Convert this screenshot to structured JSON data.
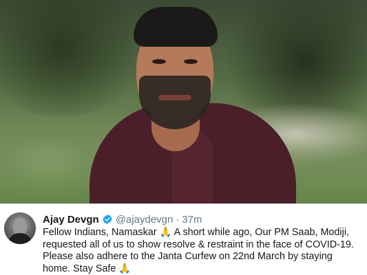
{
  "tweet": {
    "display_name": "Ajay Devgn",
    "handle": "@ajaydevgn",
    "separator": "·",
    "time": "37m",
    "text": "Fellow Indians, Namaskar 🙏 A short while ago, Our PM Saab, Modiji,\nrequested all of us to show resolve & restraint in the face of COVID-19.\nPlease also adhere to the Janta Curfew on 22nd March by staying\nhome. Stay Safe 🙏"
  },
  "colors": {
    "verified_badge": "#1da1f2",
    "text_primary": "#14171a",
    "text_secondary": "#657786",
    "shirt": "#4b1f2a"
  },
  "icons": {
    "verified": "verified-badge-icon"
  }
}
